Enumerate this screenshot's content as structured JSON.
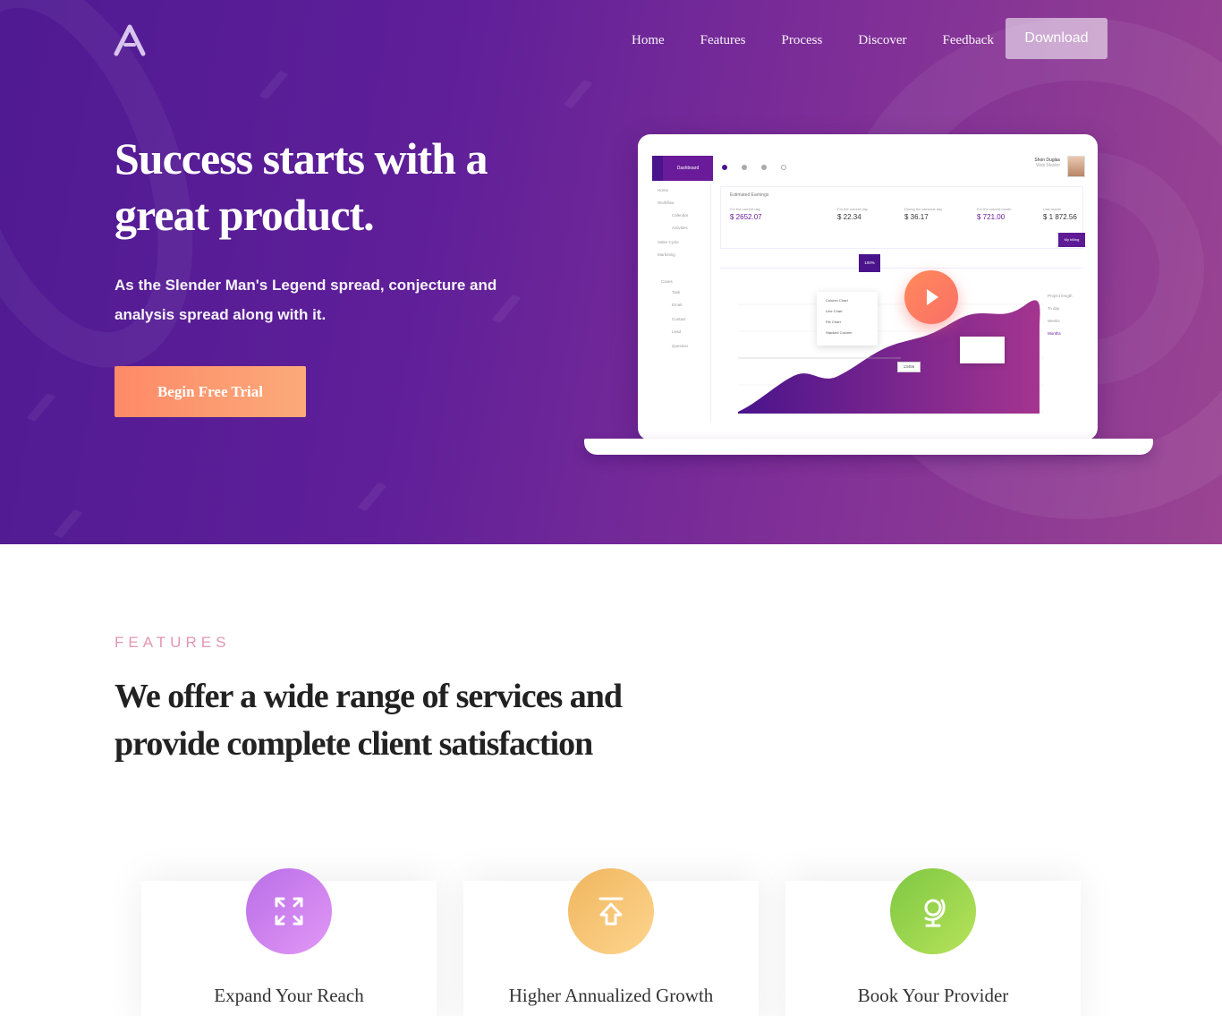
{
  "nav": {
    "items": [
      "Home",
      "Features",
      "Process",
      "Discover",
      "Feedback"
    ],
    "download_label": "Download"
  },
  "hero": {
    "title": "Success starts with a great product.",
    "subtitle": "As the Slender Man's Legend spread, conjecture and analysis spread along with it.",
    "cta_label": "Begin Free Trial"
  },
  "dashboard": {
    "tab": "Dashboard",
    "user_name": "Shon Duglas",
    "user_role": "Web Master",
    "section": "Estimated Earnings",
    "earnings": [
      {
        "label": "For the current day",
        "value": "$ 2652.07"
      },
      {
        "label": "For the current day",
        "value": "$ 22.34"
      },
      {
        "label": "During the previous day",
        "value": "$ 36.17"
      },
      {
        "label": "For the current month",
        "value": "$ 721.00"
      },
      {
        "label": "Last month",
        "value": "$ 1 872.56"
      }
    ],
    "billing": "My billing",
    "zoom": "100%",
    "tag": "13456",
    "sidebar": [
      "Home",
      "Workflow",
      "Calendar",
      "Activities",
      "Sales Cycle",
      "Marketing",
      "Cases",
      "Task",
      "Email",
      "Contact",
      "Lead",
      "Question"
    ],
    "chart_menu": [
      "Column Chart",
      "Line Chart",
      "Pie Chart",
      "Stacked Column"
    ],
    "project_length": [
      "Project length",
      "To day",
      "Weeks",
      "Months"
    ]
  },
  "features": {
    "label": "FEATURES",
    "title": "We offer a wide range of services and provide complete client satisfaction",
    "cards": [
      {
        "title": "Expand Your Reach",
        "icon": "expand-arrows-icon",
        "color_from": "#b96ee8",
        "color_to": "#e297f5"
      },
      {
        "title": "Higher Annualized Growth",
        "icon": "upload-arrow-icon",
        "color_from": "#f0b65e",
        "color_to": "#fdd58f"
      },
      {
        "title": "Book Your Provider",
        "icon": "globe-icon",
        "color_from": "#7ec743",
        "color_to": "#b7e35a"
      }
    ]
  },
  "colors": {
    "accent_cta": "#fe8a67",
    "hero_start": "#4f1a92",
    "hero_end": "#9a4492",
    "features_label": "#e495b0"
  }
}
